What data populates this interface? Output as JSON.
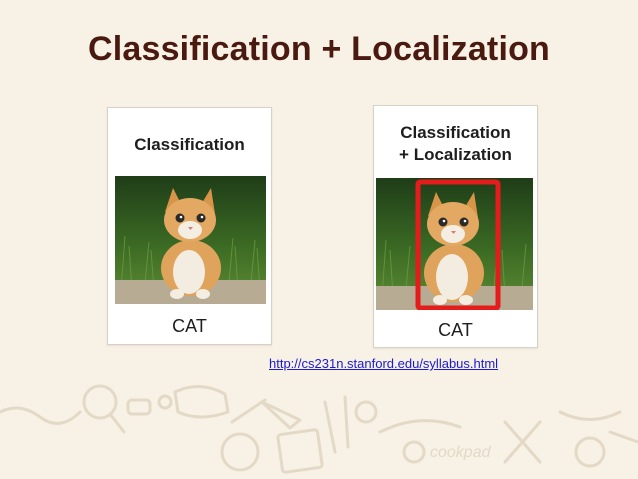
{
  "slide": {
    "title": "Classification + Localization"
  },
  "left_panel": {
    "heading": "Classification",
    "class_label": "CAT",
    "image": "kitten-photo"
  },
  "right_panel": {
    "heading_line1": "Classification",
    "heading_line2": "+ Localization",
    "class_label": "CAT",
    "image": "kitten-photo",
    "box_color": "#e41c1c"
  },
  "source_link": "http://cs231n.stanford.edu/syllabus.html",
  "watermark": {
    "text": "cookpad",
    "icon": "cooking-utensils-doodle"
  },
  "colors": {
    "title": "#4a1a10",
    "background": "#f7f1e6",
    "link": "#1b1bd1",
    "doodle": "#e3d9c6"
  }
}
